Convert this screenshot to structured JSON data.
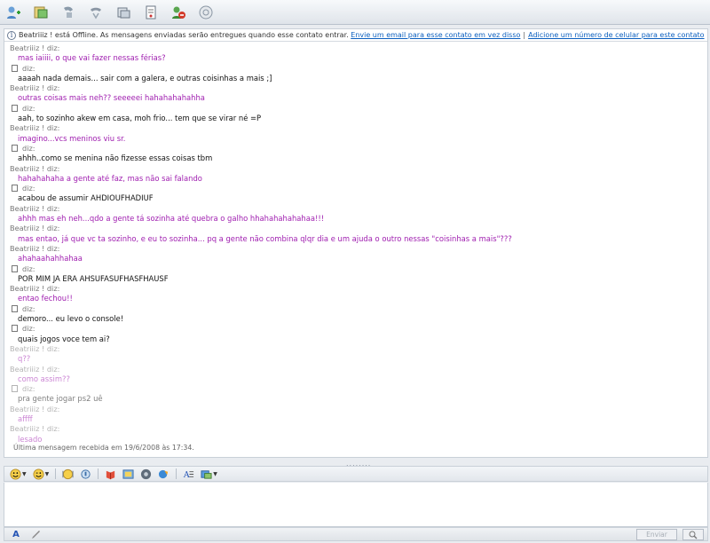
{
  "info": {
    "status_text": "Beatriiiz ! está Offline. As mensagens enviadas serão entregues quando esse contato entrar.",
    "email_link": "Envie um email para esse contato em vez disso",
    "separator": "|",
    "mobile_link": "Adicione um número de celular para este contato"
  },
  "messages": [
    {
      "sender": "Beatriiiz ! diz:",
      "text": "mas iaiiii, o que vai fazer nessas férias?",
      "from": "her"
    },
    {
      "sender": "diz:",
      "text": "aaaah nada demais... sair com a galera,  e outras coisinhas a mais ;]",
      "from": "me"
    },
    {
      "sender": "Beatriiiz ! diz:",
      "text": "outras coisas mais neh?? seeeeei hahahahahahha",
      "from": "her"
    },
    {
      "sender": "diz:",
      "text": "aah, to sozinho akew em casa, moh frio... tem que se virar né =P",
      "from": "me"
    },
    {
      "sender": "Beatriiiz ! diz:",
      "text": "imagino...vcs meninos viu sr.",
      "from": "her"
    },
    {
      "sender": "diz:",
      "text": "ahhh..como se menina não fizesse essas coisas tbm",
      "from": "me"
    },
    {
      "sender": "Beatriiiz ! diz:",
      "text": "hahahahaha a gente até faz, mas não sai falando",
      "from": "her"
    },
    {
      "sender": "diz:",
      "text": "acabou de assumir AHDIOUFHADIUF",
      "from": "me"
    },
    {
      "sender": "Beatriiiz ! diz:",
      "text": "ahhh mas eh neh...qdo a gente tá sozinha até quebra o galho hhahahahahahaa!!!",
      "from": "her"
    },
    {
      "sender": "Beatriiiz ! diz:",
      "text": "mas entao, já que vc ta sozinho, e eu to sozinha... pq a gente não combina qlqr dia e um ajuda o outro nessas \"coisinhas a mais\"???",
      "from": "her"
    },
    {
      "sender": "Beatriiiz ! diz:",
      "text": "ahahaahahhahaa",
      "from": "her"
    },
    {
      "sender": "diz:",
      "text": "POR MIM JA ERA AHSUFASUFHASFHAUSF",
      "from": "me"
    },
    {
      "sender": "Beatriiiz ! diz:",
      "text": "entao fechou!!",
      "from": "her"
    },
    {
      "sender": "diz:",
      "text": "demoro... eu levo o console!",
      "from": "me"
    },
    {
      "sender": "diz:",
      "text": "quais jogos voce tem ai?",
      "from": "me"
    },
    {
      "sender": "Beatriiiz ! diz:",
      "text": "q??",
      "from": "her",
      "faded": true
    },
    {
      "sender": "Beatriiiz ! diz:",
      "text": "como assim??",
      "from": "her",
      "faded": true
    },
    {
      "sender": "diz:",
      "text": "pra gente jogar ps2 uê",
      "from": "me",
      "faded": true
    },
    {
      "sender": "Beatriiiz ! diz:",
      "text": "affff",
      "from": "her",
      "faded": true
    },
    {
      "sender": "Beatriiiz ! diz:",
      "text": "lesado",
      "from": "her",
      "faded": true
    }
  ],
  "status_bar": {
    "last_message": "Última mensagem recebida em 19/6/2008 às 17:34."
  },
  "splitter": {
    "grip": "........"
  },
  "bottom": {
    "send_label": "Enviar",
    "font_tab": "A"
  },
  "colors": {
    "contact_text": "#a020b0",
    "my_text": "#111111",
    "link": "#0b5fbf"
  },
  "toolbar_icons": [
    "invite-contact-icon",
    "send-files-icon",
    "video-call-icon",
    "voice-call-icon",
    "activities-icon",
    "games-icon",
    "block-contact-icon",
    "display-picture-icon"
  ],
  "format_icons": [
    "emoticon-icon",
    "wink-icon",
    "nudge-icon",
    "voice-clip-icon",
    "winks-menu-icon",
    "background-icon",
    "display-picture-icon",
    "handwriting-icon",
    "font-icon",
    "send-files-icon"
  ]
}
